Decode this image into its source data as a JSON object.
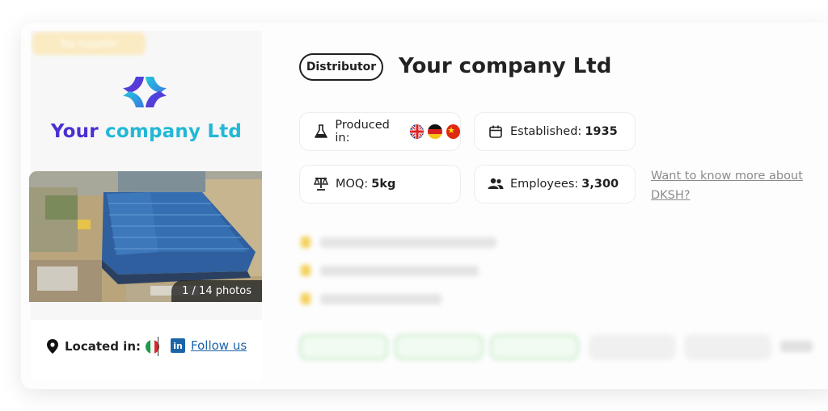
{
  "header": {
    "badge": "Top Supplier",
    "tag": "Distributor",
    "company_name": "Your company Ltd"
  },
  "logo": {
    "name_part1": "Your ",
    "name_part2": "company Ltd",
    "colors": {
      "primary": "#4a2fd2",
      "accent": "#22b8d6"
    }
  },
  "gallery": {
    "photo_count": "1 / 14 photos"
  },
  "footer": {
    "located_label": "Located in:",
    "country_flag": "italy-flag-icon",
    "follow_label": "Follow us",
    "social_icon": "linkedin-icon"
  },
  "facts": {
    "produced_label": "Produced in:",
    "produced_flags": [
      "uk-flag-icon",
      "germany-flag-icon",
      "china-flag-icon"
    ],
    "established_label": "Established:",
    "established_value": "1935",
    "moq_label": "MOQ:",
    "moq_value": "5kg",
    "employees_label": "Employees:",
    "employees_value": "3,300"
  },
  "more_link": "Want to know more about DKSH?",
  "colors": {
    "link": "#1c64a8",
    "muted_link": "#8b8b8b",
    "text": "#1f1f1f"
  }
}
